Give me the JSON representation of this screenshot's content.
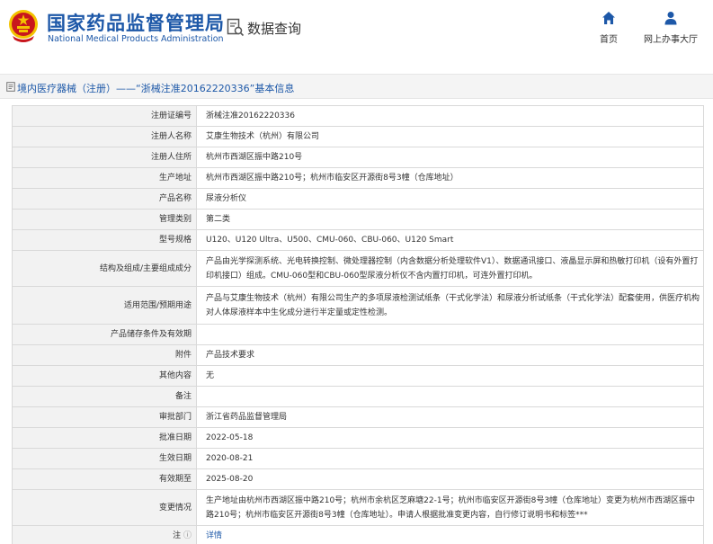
{
  "header": {
    "site_title": "国家药品监督管理局",
    "site_subtitle": "National Medical Products Administration",
    "section_title": "数据查询",
    "nav": [
      {
        "label": "首页",
        "icon": "home-icon"
      },
      {
        "label": "网上办事大厅",
        "icon": "person-icon"
      }
    ]
  },
  "breadcrumb": {
    "text": "境内医疗器械（注册）——“浙械注准20162220336”基本信息"
  },
  "fields": [
    {
      "label": "注册证编号",
      "value": "浙械注准20162220336"
    },
    {
      "label": "注册人名称",
      "value": "艾康生物技术（杭州）有限公司"
    },
    {
      "label": "注册人住所",
      "value": "杭州市西湖区振中路210号"
    },
    {
      "label": "生产地址",
      "value": "杭州市西湖区振中路210号；杭州市临安区开源街8号3幢（仓库地址）"
    },
    {
      "label": "产品名称",
      "value": "尿液分析仪"
    },
    {
      "label": "管理类别",
      "value": "第二类"
    },
    {
      "label": "型号规格",
      "value": "U120、U120 Ultra、U500、CMU-060、CBU-060、U120 Smart"
    },
    {
      "label": "结构及组成/主要组成成分",
      "value": "产品由光学探测系统、光电转换控制、微处理器控制（内含数据分析处理软件V1）、数据通讯接口、液晶显示屏和热敏打印机（设有外置打印机接口）组成。CMU-060型和CBU-060型尿液分析仪不含内置打印机，可连外置打印机。"
    },
    {
      "label": "适用范围/预期用途",
      "value": "产品与艾康生物技术（杭州）有限公司生产的多项尿液检测试纸条（干式化学法）和尿液分析试纸条（干式化学法）配套使用，供医疗机构对人体尿液样本中生化成分进行半定量或定性检测。"
    },
    {
      "label": "产品储存条件及有效期",
      "value": ""
    },
    {
      "label": "附件",
      "value": "产品技术要求"
    },
    {
      "label": "其他内容",
      "value": "无"
    },
    {
      "label": "备注",
      "value": ""
    },
    {
      "label": "审批部门",
      "value": "浙江省药品监督管理局"
    },
    {
      "label": "批准日期",
      "value": "2022-05-18"
    },
    {
      "label": "生效日期",
      "value": "2020-08-21"
    },
    {
      "label": "有效期至",
      "value": "2025-08-20"
    },
    {
      "label": "变更情况",
      "value": "生产地址由杭州市西湖区振中路210号；杭州市余杭区芝麻塘22-1号；杭州市临安区开源街8号3幢（仓库地址）变更为杭州市西湖区振中路210号；杭州市临安区开源街8号3幢（仓库地址）。申请人根据批准变更内容，自行修订说明书和标签***"
    }
  ],
  "note_row": {
    "label": "注",
    "link_text": "详情"
  },
  "colors": {
    "brand_blue": "#1d58a8",
    "emblem_red": "#c8161d",
    "emblem_gold": "#f3c300",
    "label_bg": "#f2f2f2",
    "border": "#d9d9d9"
  }
}
